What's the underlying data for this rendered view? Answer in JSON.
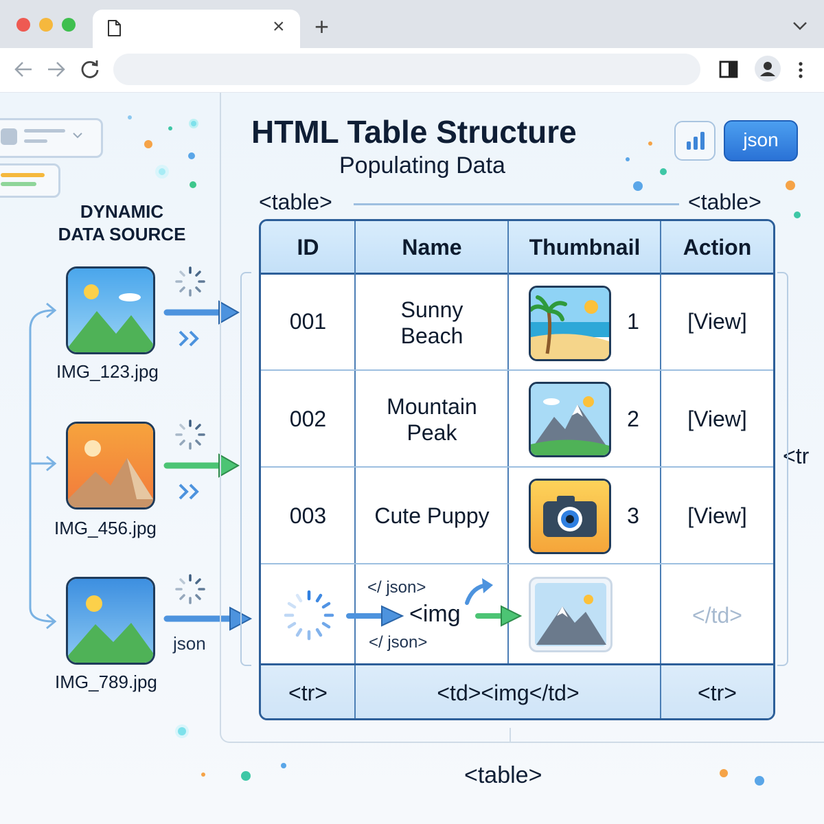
{
  "browser": {
    "tab_close": "×",
    "new_tab": "+",
    "menu_chevron": "⌄",
    "back_icon": "←",
    "forward_icon": "→",
    "reload_icon": "↻",
    "more_icon": "⋮"
  },
  "header": {
    "title": "HTML Table Structure",
    "subtitle": "Populating Data",
    "json_button": "json"
  },
  "source": {
    "heading_line1": "DYNAMIC",
    "heading_line2": "DATA SOURCE",
    "files": [
      "IMG_123.jpg",
      "IMG_456.jpg",
      "IMG_789.jpg"
    ],
    "json_label": "json"
  },
  "table_labels": {
    "top_left": "<table>",
    "top_right": "<table>",
    "bottom": "<table>",
    "side_tr": "<tr"
  },
  "table": {
    "columns": [
      "ID",
      "Name",
      "Thumbnail",
      "Action"
    ],
    "rows": [
      {
        "id": "001",
        "name_line1": "Sunny",
        "name_line2": "Beach",
        "num": "1",
        "action": "[View]"
      },
      {
        "id": "002",
        "name_line1": "Mountain",
        "name_line2": "Peak",
        "num": "2",
        "action": "[View]"
      },
      {
        "id": "003",
        "name_line1": "Cute Puppy",
        "name_line2": "",
        "num": "3",
        "action": "[View]"
      }
    ],
    "loading_row": {
      "json_top": "</ json>",
      "img_tag": "<img",
      "json_bottom": "</ json>",
      "td_close": "</td>"
    },
    "footer": {
      "tr_left": "<tr>",
      "td_img": "<td><img</td>",
      "tr_right": "<tr>"
    }
  },
  "colors": {
    "accent_blue": "#2f7fe0",
    "table_border": "#2d5f99",
    "header_fill": "#cfe6fb",
    "green_arrow": "#4cc474"
  }
}
